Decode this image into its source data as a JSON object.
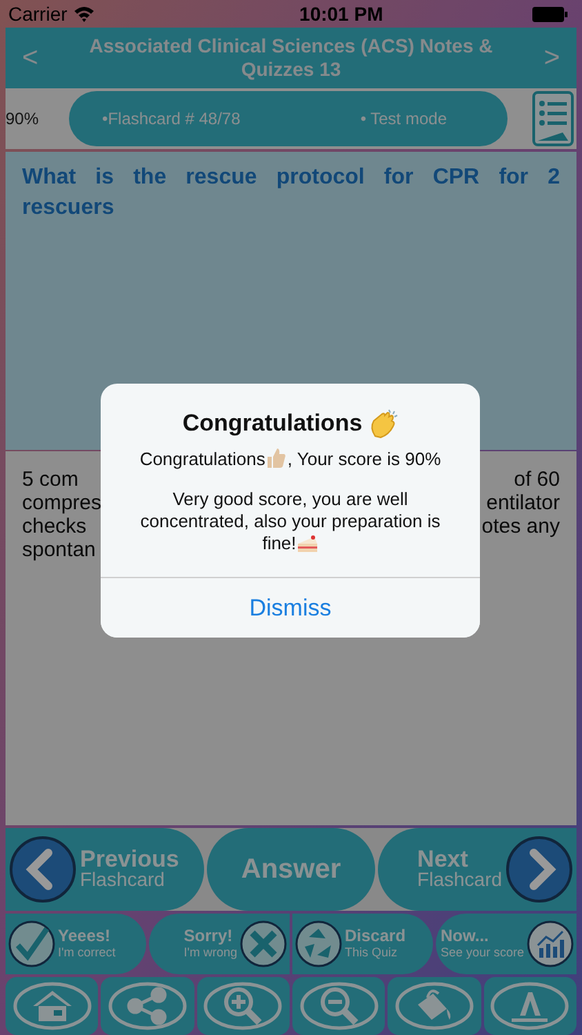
{
  "status_bar": {
    "carrier": "Carrier",
    "time": "10:01 PM"
  },
  "header": {
    "prev": "<",
    "title": "Associated Clinical Sciences (ACS) Notes & Quizzes 13",
    "next": ">"
  },
  "info": {
    "score": "90%",
    "flashcard": "•Flashcard #  48/78",
    "mode": "• Test mode"
  },
  "question": "What is the rescue protocol for CPR for 2 rescuers",
  "answer_lines": [
    {
      "left": "5 com",
      "right": "of 60"
    },
    {
      "left": "compres",
      "right": "entilator"
    },
    {
      "left": "checks",
      "right": "otes any"
    },
    {
      "left": "spontan"
    }
  ],
  "nav": [
    {
      "kind": "prev",
      "title": "Previous",
      "subtitle": "Flashcard"
    },
    {
      "kind": "answer",
      "title": "Answer"
    },
    {
      "kind": "next",
      "title": "Next",
      "subtitle": "Flashcard"
    }
  ],
  "actions": [
    {
      "kind": "correct",
      "title": "Yeees!",
      "subtitle": "I'm correct"
    },
    {
      "kind": "wrong",
      "title": "Sorry!",
      "subtitle": "I'm wrong"
    },
    {
      "kind": "discard",
      "title": "Discard",
      "subtitle": "This Quiz"
    },
    {
      "kind": "score",
      "title": "Now...",
      "subtitle": "See your score"
    }
  ],
  "tools": [
    {
      "kind": "home"
    },
    {
      "kind": "share"
    },
    {
      "kind": "zoom_in"
    },
    {
      "kind": "zoom_out"
    },
    {
      "kind": "paint"
    },
    {
      "kind": "font"
    }
  ],
  "alert": {
    "title": "Congratulations",
    "score_before": "Congratulations",
    "score_after": ", Your score is 90%",
    "message": "Very good score, you are well concentrated, also your preparation is",
    "message_end": "fine!",
    "button": "Dismiss"
  }
}
